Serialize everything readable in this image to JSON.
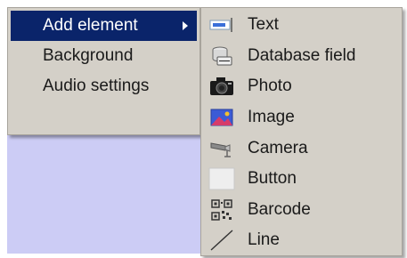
{
  "main_menu": {
    "items": [
      {
        "label": "Add element",
        "selected": true,
        "has_submenu": true
      },
      {
        "label": "Background",
        "selected": false,
        "has_submenu": false
      },
      {
        "label": "Audio settings",
        "selected": false,
        "has_submenu": false
      }
    ]
  },
  "submenu": {
    "items": [
      {
        "label": "Text",
        "icon": "text-icon"
      },
      {
        "label": "Database field",
        "icon": "database-field-icon"
      },
      {
        "label": "Photo",
        "icon": "photo-camera-icon"
      },
      {
        "label": "Image",
        "icon": "image-icon"
      },
      {
        "label": "Camera",
        "icon": "security-camera-icon"
      },
      {
        "label": "Button",
        "icon": "button-icon"
      },
      {
        "label": "Barcode",
        "icon": "barcode-icon"
      },
      {
        "label": "Line",
        "icon": "line-icon"
      }
    ]
  },
  "colors": {
    "menu_background": "#d4d0c8",
    "selection": "#0a246a",
    "canvas": "#ccccf5"
  }
}
